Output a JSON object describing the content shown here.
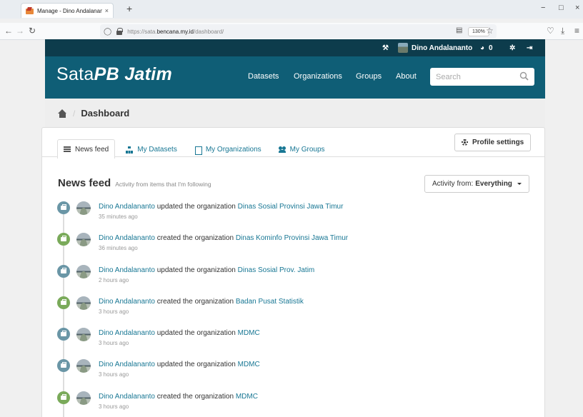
{
  "browser": {
    "tab_title": "Manage - Dino Andalananto - S",
    "tab_close": "×",
    "new_tab": "+",
    "url_prefix": "https://sata.",
    "url_domain": "bencana.my.id",
    "url_path": "/dashboard/",
    "zoom": "130%",
    "window_controls": {
      "minimize": "−",
      "maximize": "□",
      "close": "×"
    }
  },
  "account": {
    "user_name": "Dino Andalananto",
    "dashboard_count": "0"
  },
  "site": {
    "logo_plain": "Sata",
    "logo_italic": "PB Jatim",
    "nav": [
      "Datasets",
      "Organizations",
      "Groups",
      "About"
    ],
    "search_placeholder": "Search"
  },
  "breadcrumb": {
    "current": "Dashboard",
    "separator": "/"
  },
  "dashboard": {
    "tabs": [
      "News feed",
      "My Datasets",
      "My Organizations",
      "My Groups"
    ],
    "active_tab": "News feed",
    "profile_button": "Profile settings",
    "feed_heading": "News feed",
    "feed_subheading": "Activity from items that I'm following",
    "activity_filter_label": "Activity from:",
    "activity_filter_value": "Everything"
  },
  "activities": [
    {
      "type": "updated",
      "actor": "Dino Andalananto",
      "verb": "updated the organization",
      "target": "Dinas Sosial Provinsi Jawa Timur",
      "time": "35 minutes ago"
    },
    {
      "type": "created",
      "actor": "Dino Andalananto",
      "verb": "created the organization",
      "target": "Dinas Kominfo Provinsi Jawa Timur",
      "time": "36 minutes ago"
    },
    {
      "type": "updated",
      "actor": "Dino Andalananto",
      "verb": "updated the organization",
      "target": "Dinas Sosial Prov. Jatim",
      "time": "2 hours ago"
    },
    {
      "type": "created",
      "actor": "Dino Andalananto",
      "verb": "created the organization",
      "target": "Badan Pusat Statistik",
      "time": "3 hours ago"
    },
    {
      "type": "updated",
      "actor": "Dino Andalananto",
      "verb": "updated the organization",
      "target": "MDMC",
      "time": "3 hours ago"
    },
    {
      "type": "updated",
      "actor": "Dino Andalananto",
      "verb": "updated the organization",
      "target": "MDMC",
      "time": "3 hours ago"
    },
    {
      "type": "created",
      "actor": "Dino Andalananto",
      "verb": "created the organization",
      "target": "MDMC",
      "time": "3 hours ago"
    }
  ],
  "colors": {
    "account_bar": "#0d3c4c",
    "masthead": "#0f5e76",
    "link": "#187794",
    "badge_updated": "#6a96a6",
    "badge_created": "#7aaa5a"
  }
}
